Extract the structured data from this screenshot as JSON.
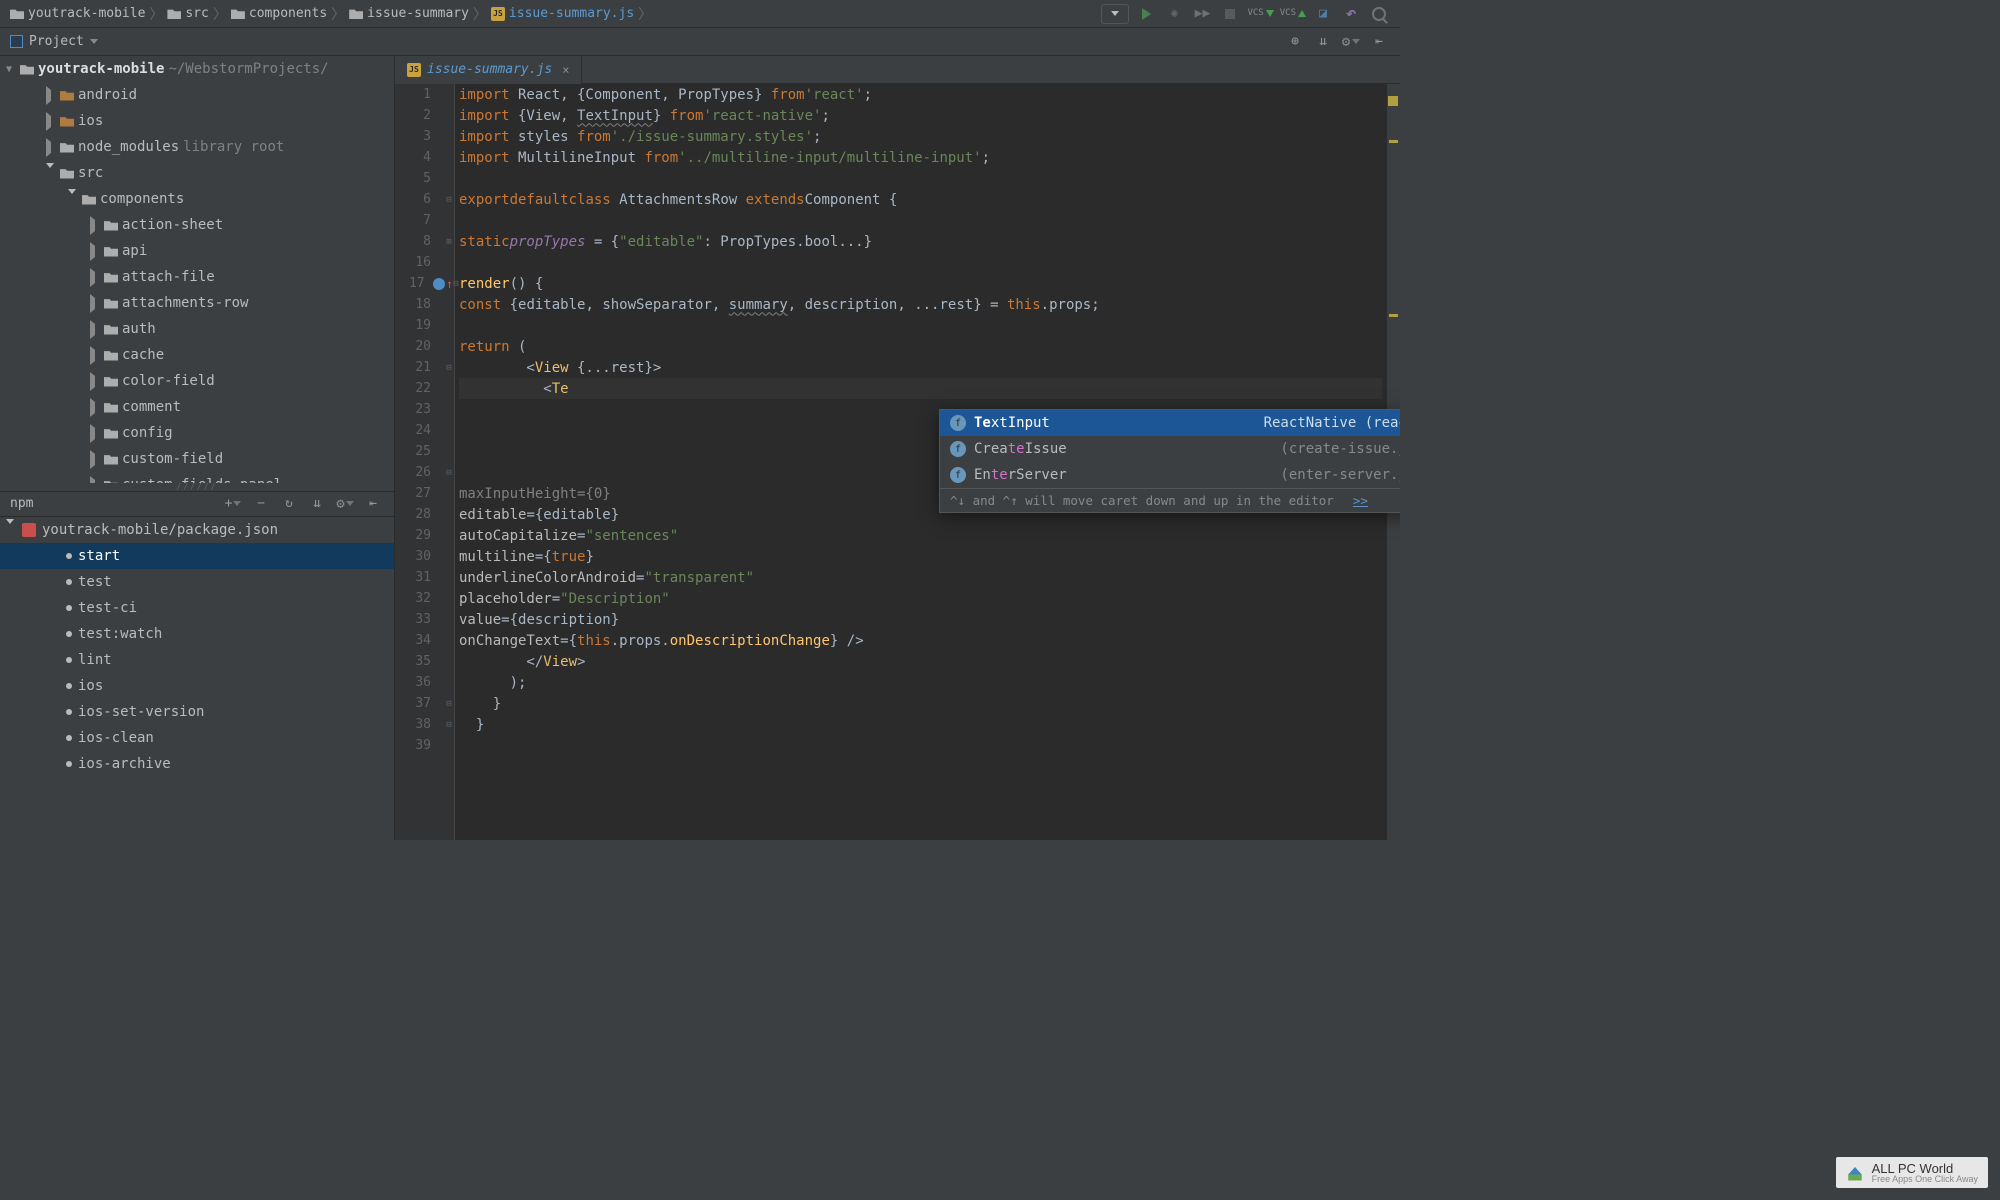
{
  "breadcrumb": [
    {
      "icon": "folder",
      "label": "youtrack-mobile"
    },
    {
      "icon": "folder",
      "label": "src"
    },
    {
      "icon": "folder",
      "label": "components"
    },
    {
      "icon": "folder",
      "label": "issue-summary"
    },
    {
      "icon": "js",
      "label": "issue-summary.js"
    }
  ],
  "toolbar": {
    "vcs_label": "VCS"
  },
  "project_bar": {
    "label": "Project"
  },
  "tree": {
    "root_name": "youtrack-mobile",
    "root_path": "~/WebstormProjects/",
    "items": [
      {
        "depth": 1,
        "arrow": "right",
        "icon": "folder-orange",
        "label": "android"
      },
      {
        "depth": 1,
        "arrow": "right",
        "icon": "folder-orange",
        "label": "ios"
      },
      {
        "depth": 1,
        "arrow": "right",
        "icon": "folder",
        "label": "node_modules",
        "suffix": "library root"
      },
      {
        "depth": 1,
        "arrow": "down",
        "icon": "folder",
        "label": "src"
      },
      {
        "depth": 2,
        "arrow": "down",
        "icon": "folder",
        "label": "components"
      },
      {
        "depth": 3,
        "arrow": "right",
        "icon": "folder",
        "label": "action-sheet"
      },
      {
        "depth": 3,
        "arrow": "right",
        "icon": "folder",
        "label": "api"
      },
      {
        "depth": 3,
        "arrow": "right",
        "icon": "folder",
        "label": "attach-file"
      },
      {
        "depth": 3,
        "arrow": "right",
        "icon": "folder",
        "label": "attachments-row"
      },
      {
        "depth": 3,
        "arrow": "right",
        "icon": "folder",
        "label": "auth"
      },
      {
        "depth": 3,
        "arrow": "right",
        "icon": "folder",
        "label": "cache"
      },
      {
        "depth": 3,
        "arrow": "right",
        "icon": "folder",
        "label": "color-field"
      },
      {
        "depth": 3,
        "arrow": "right",
        "icon": "folder",
        "label": "comment"
      },
      {
        "depth": 3,
        "arrow": "right",
        "icon": "folder",
        "label": "config"
      },
      {
        "depth": 3,
        "arrow": "right",
        "icon": "folder",
        "label": "custom-field"
      },
      {
        "depth": 3,
        "arrow": "right",
        "icon": "folder",
        "label": "custom-fields-panel"
      }
    ]
  },
  "npm": {
    "label": "npm",
    "pkg": "youtrack-mobile/package.json",
    "scripts": [
      "start",
      "test",
      "test-ci",
      "test:watch",
      "lint",
      "ios",
      "ios-set-version",
      "ios-clean",
      "ios-archive"
    ]
  },
  "editor": {
    "tab_filename": "issue-summary.js",
    "lines": [
      {
        "n": 1,
        "html": "<span class='kw'>import</span> React, {Component, PropTypes} <span class='kw'>from</span> <span class='str'>'react'</span>;"
      },
      {
        "n": 2,
        "html": "<span class='kw'>import</span> {View, <span class='underline'>TextInput</span>} <span class='kw'>from</span> <span class='str'>'react-native'</span>;"
      },
      {
        "n": 3,
        "html": "<span class='kw'>import</span> styles <span class='kw'>from</span> <span class='str'>'./issue-summary.styles'</span>;"
      },
      {
        "n": 4,
        "html": "<span class='kw'>import</span> MultilineInput <span class='kw'>from</span> <span class='str'>'../multiline-input/multiline-input'</span>;"
      },
      {
        "n": 5,
        "html": ""
      },
      {
        "n": 6,
        "fold": "-",
        "html": "<span class='kw'>export</span> <span class='kw'>default</span> <span class='kw'>class</span> AttachmentsRow <span class='kw'>extends</span> <span class='type'>Component</span> {"
      },
      {
        "n": 7,
        "html": ""
      },
      {
        "n": 8,
        "fold": "+",
        "html": "  <span class='kw'>static</span> <span class='prop'>propTypes</span> = {<span class='str'>\"editable\"</span>: PropTypes.bool...}"
      },
      {
        "n": 16,
        "html": ""
      },
      {
        "n": 17,
        "mark": "override",
        "fold": "-",
        "html": "  <span class='func'>render</span>() {"
      },
      {
        "n": 18,
        "html": "    <span class='kw'>const</span> {<span class='param'>editable</span>, <span class='param'>showSeparator</span>, <span class='underline param'>summary</span>, <span class='param'>description</span>, ...<span class='param'>rest</span>} = <span class='this'>this</span>.props;"
      },
      {
        "n": 19,
        "html": ""
      },
      {
        "n": 20,
        "html": "    <span class='kw'>return</span> ("
      },
      {
        "n": 21,
        "fold": "-",
        "html": "      &lt;<span class='tag'>View</span> {...rest}&gt;"
      },
      {
        "n": 22,
        "highlight": true,
        "html": "        &lt;<span class='tag'>Te</span>"
      },
      {
        "n": 23,
        "html": ""
      },
      {
        "n": 24,
        "html": ""
      },
      {
        "n": 25,
        "html": ""
      },
      {
        "n": 26,
        "fold": "-",
        "html": ""
      },
      {
        "n": 27,
        "html": "          <span class='muted'>maxInputHeight={0}</span>"
      },
      {
        "n": 28,
        "html": "          <span class='attr'>editable</span>={<span class='param'>editable</span>}"
      },
      {
        "n": 29,
        "html": "          <span class='attr'>autoCapitalize</span>=<span class='str'>\"sentences\"</span>"
      },
      {
        "n": 30,
        "html": "          <span class='attr'>multiline</span>={<span class='kw'>true</span>}"
      },
      {
        "n": 31,
        "html": "          <span class='attr'>underlineColorAndroid</span>=<span class='str'>\"transparent\"</span>"
      },
      {
        "n": 32,
        "html": "          <span class='attr'>placeholder</span>=<span class='str'>\"Description\"</span>"
      },
      {
        "n": 33,
        "html": "          <span class='attr'>value</span>={<span class='param'>description</span>}"
      },
      {
        "n": 34,
        "html": "          <span class='attr'>onChangeText</span>={<span class='this'>this</span>.props.<span class='func'>onDescriptionChange</span>} /&gt;"
      },
      {
        "n": 35,
        "html": "      &lt;/<span class='tag'>View</span>&gt;"
      },
      {
        "n": 36,
        "html": "    );"
      },
      {
        "n": 37,
        "fold": "-",
        "html": "  }"
      },
      {
        "n": 38,
        "fold": "-",
        "html": "}"
      },
      {
        "n": 39,
        "html": ""
      }
    ]
  },
  "completion": {
    "rows": [
      {
        "selected": true,
        "label_pre": "Te",
        "label_match": "xtInput",
        "origin": "ReactNative (react-native.js, react-native)"
      },
      {
        "selected": false,
        "label_html": "Crea<span class='match'>te</span>Issue",
        "origin": "(create-issue.js, src/views/create-issue)"
      },
      {
        "selected": false,
        "label_html": "En<span class='match'>te</span>rServer",
        "origin": "(enter-server.js, src/views/enter-server)"
      }
    ],
    "hint_text": "^↓ and ^↑ will move caret down and up in the editor",
    "hint_link": ">>"
  },
  "watermark": {
    "title": "ALL PC World",
    "subtitle": "Free Apps One Click Away"
  }
}
